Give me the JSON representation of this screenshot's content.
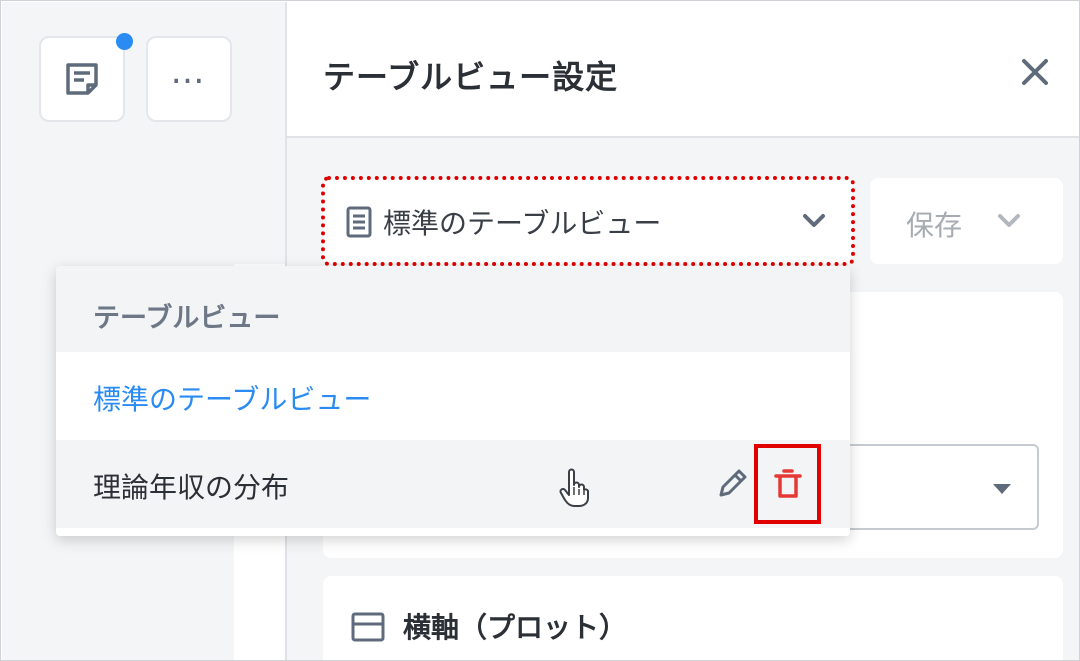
{
  "panel": {
    "title": "テーブルビュー設定",
    "close_icon": "close-icon"
  },
  "view_selector": {
    "selected_label": "標準のテーブルビュー",
    "icon": "document-icon"
  },
  "save_button": {
    "label": "保存"
  },
  "dropdown": {
    "header": "テーブルビュー",
    "items": [
      {
        "label": "標準のテーブルビュー",
        "state": "selected"
      },
      {
        "label": "理論年収の分布",
        "state": "hover"
      }
    ]
  },
  "horizontal_axis_section": {
    "label": "横軸（プロット）"
  },
  "rail": {
    "note_icon": "note-icon",
    "more_icon": "more-icon"
  },
  "colors": {
    "accent": "#2a8bf2",
    "danger": "#e10000",
    "delete_icon": "#e53935"
  }
}
